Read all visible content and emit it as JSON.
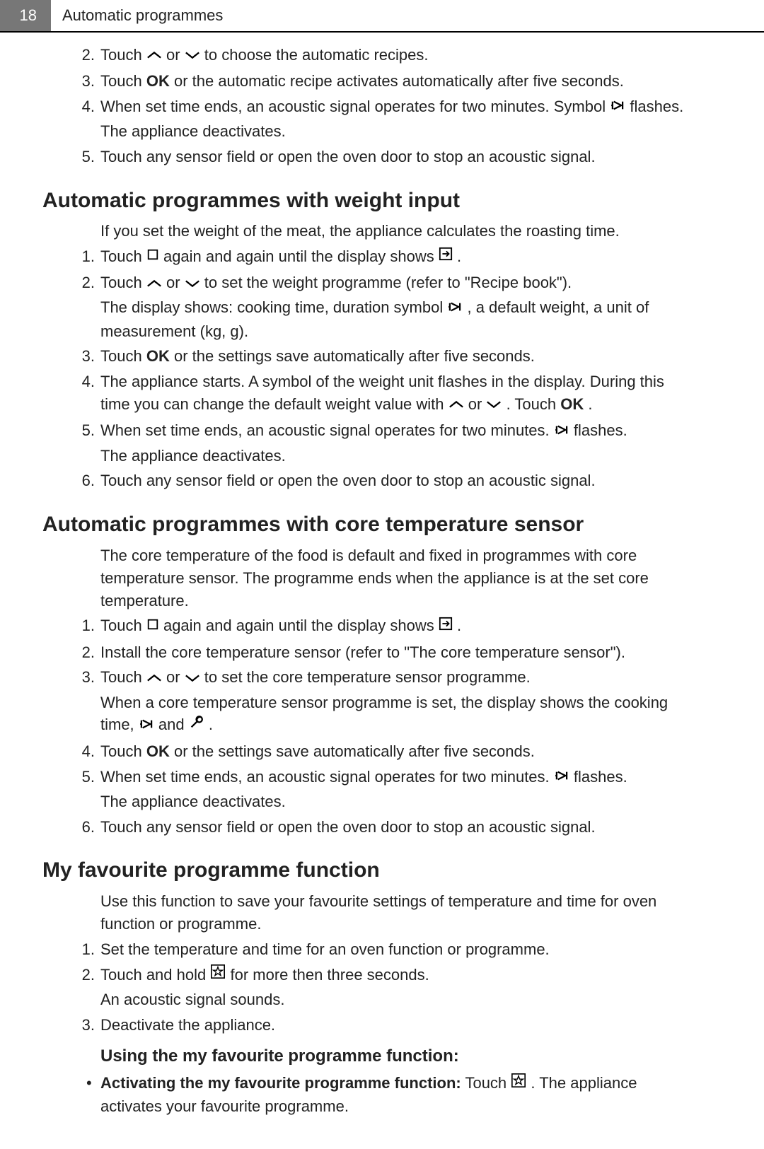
{
  "header": {
    "page_number": "18",
    "title": "Automatic programmes"
  },
  "intro_steps": [
    {
      "n": "2.",
      "text_a": "Touch ",
      "icon1": "up",
      "mid": " or ",
      "icon2": "down",
      "text_b": " to choose the automatic recipes."
    },
    {
      "n": "3.",
      "text_a": "Touch ",
      "ok": "OK",
      "text_b": " or the automatic recipe activates automatically after five seconds."
    },
    {
      "n": "4.",
      "text_a": "When set time ends, an acoustic signal operates for two minutes. Symbol ",
      "icon1": "duration",
      "text_b": " flashes.",
      "sub": "The appliance deactivates."
    },
    {
      "n": "5.",
      "text_a": "Touch any sensor field or open the oven door to stop an acoustic signal."
    }
  ],
  "section_weight": {
    "heading": "Automatic programmes with weight input",
    "intro": "If you set the weight of the meat, the appliance calculates the roasting time.",
    "steps": [
      {
        "n": "1.",
        "text_a": "Touch ",
        "icon1": "square",
        "mid": " again and again until the display shows ",
        "icon2": "autobox",
        "text_b": " ."
      },
      {
        "n": "2.",
        "text_a": "Touch ",
        "icon1": "up",
        "mida": " or ",
        "icon2": "down",
        "text_b": " to set the weight programme (refer to \"Recipe book\").",
        "sub_a": "The display shows: cooking time, duration symbol ",
        "sub_icon": "duration",
        "sub_b": " , a default weight, a unit of measurement (kg, g)."
      },
      {
        "n": "3.",
        "text_a": "Touch ",
        "ok": "OK",
        "text_b": " or the settings save automatically after five seconds."
      },
      {
        "n": "4.",
        "text_a": "The appliance starts. A symbol of the weight unit flashes in the display. During this time you can change the default weight value with ",
        "icon1": "up",
        "mid": " or ",
        "icon2": "down",
        "text_b": " . Touch ",
        "ok": "OK",
        "tail": " ."
      },
      {
        "n": "5.",
        "text_a": "When set time ends, an acoustic signal operates for two minutes. ",
        "icon1": "duration",
        "text_b": " flashes.",
        "sub": "The appliance deactivates."
      },
      {
        "n": "6.",
        "text_a": "Touch any sensor field or open the oven door to stop an acoustic signal."
      }
    ]
  },
  "section_core": {
    "heading": "Automatic programmes with core temperature sensor",
    "intro": "The core temperature of the food is default and fixed in programmes with core temperature sensor. The programme ends when the appliance is at the set core temperature.",
    "steps": [
      {
        "n": "1.",
        "text_a": "Touch ",
        "icon1": "square",
        "mid": " again and again until the display shows ",
        "icon2": "autobox",
        "text_b": " ."
      },
      {
        "n": "2.",
        "text_a": "Install the core temperature sensor (refer to \"The core temperature sensor\")."
      },
      {
        "n": "3.",
        "text_a": "Touch ",
        "icon1": "up",
        "mida": " or ",
        "icon2": "down",
        "text_b": " to set the core temperature sensor programme.",
        "sub_a": "When a core temperature sensor programme is set, the display shows the cooking time, ",
        "sub_icon1": "duration",
        "sub_mid": " and ",
        "sub_icon2": "probe",
        "sub_b": " ."
      },
      {
        "n": "4.",
        "text_a": "Touch ",
        "ok": "OK",
        "text_b": " or the settings save automatically after five seconds."
      },
      {
        "n": "5.",
        "text_a": "When set time ends, an acoustic signal operates for two minutes. ",
        "icon1": "duration",
        "text_b": " flashes.",
        "sub": "The appliance deactivates."
      },
      {
        "n": "6.",
        "text_a": "Touch any sensor field or open the oven door to stop an acoustic signal."
      }
    ]
  },
  "section_fav": {
    "heading": "My favourite programme function",
    "intro": "Use this function to save your favourite settings of temperature and time for oven function or programme.",
    "steps": [
      {
        "n": "1.",
        "text_a": "Set the temperature and time for an oven function or programme."
      },
      {
        "n": "2.",
        "text_a": "Touch and hold ",
        "icon1": "star",
        "text_b": " for more then three seconds.",
        "sub": "An acoustic signal sounds."
      },
      {
        "n": "3.",
        "text_a": "Deactivate the appliance."
      }
    ],
    "using_heading": "Using the my favourite programme function:",
    "bullets": [
      {
        "bold": "Activating the my favourite programme function:",
        "text_a": " Touch ",
        "icon1": "star",
        "text_b": " . The appliance activates your favourite programme."
      }
    ]
  }
}
